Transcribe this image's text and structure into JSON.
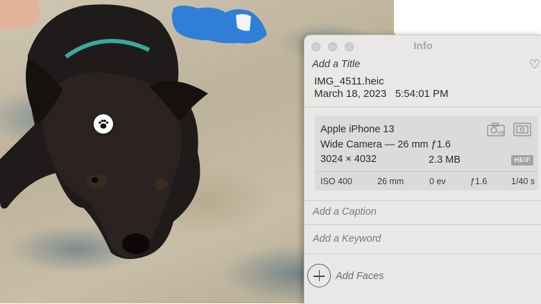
{
  "window": {
    "title": "Info"
  },
  "photo": {
    "badge_icon": "paw-icon",
    "subject": "black dog lying on rug with blue plush toy"
  },
  "info": {
    "add_title_placeholder": "Add a Title",
    "favorite_icon": "heart-icon",
    "filename": "IMG_4511.heic",
    "date": "March 18, 2023",
    "time": "5:54:01 PM",
    "camera": {
      "model": "Apple iPhone 13",
      "lens": "Wide Camera — 26 mm ƒ1.6",
      "resolution": "3024 × 4032",
      "file_size": "2.3 MB",
      "format_badge": "HEIF",
      "icons": [
        "white-balance-icon",
        "metering-icon"
      ],
      "exif": {
        "iso": "ISO 400",
        "focal_length": "26 mm",
        "exposure_bias": "0 ev",
        "aperture": "ƒ1.6",
        "shutter": "1/40 s"
      }
    },
    "caption_placeholder": "Add a Caption",
    "keyword_placeholder": "Add a Keyword",
    "add_faces_label": "Add Faces"
  },
  "colors": {
    "panel_bg": "#e9e8e7",
    "camera_box_bg": "#dcdbda",
    "toy_blue": "#2f7ed8"
  }
}
